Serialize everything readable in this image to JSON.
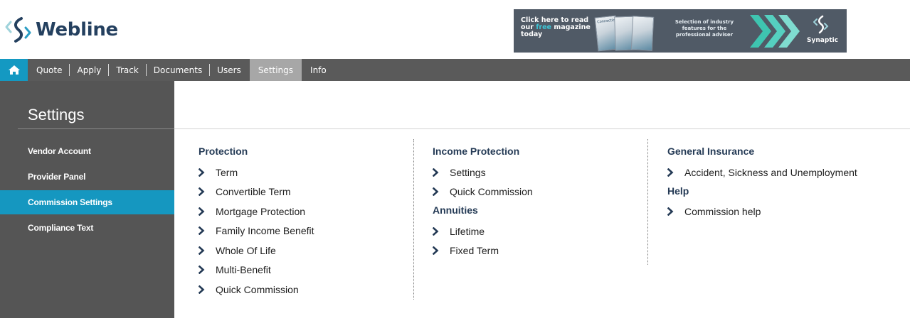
{
  "brand": {
    "name": "Webline",
    "colors": {
      "navy": "#24405f",
      "accent": "#1597c0",
      "nav_bg": "#5a5a5a",
      "sidebar_bg": "#555555"
    }
  },
  "banner": {
    "text_before": "Click here to read our ",
    "highlight": "free",
    "text_after": " magazine today",
    "magazine_label": "Connection",
    "tagline": "Selection of industry features for the professional adviser",
    "partner": "Synaptic"
  },
  "nav": {
    "home_icon": "home-icon",
    "items": [
      {
        "label": "Quote"
      },
      {
        "label": "Apply"
      },
      {
        "label": "Track"
      },
      {
        "label": "Documents"
      },
      {
        "label": "Users"
      },
      {
        "label": "Settings",
        "active": true
      },
      {
        "label": "Info"
      }
    ]
  },
  "sidebar": {
    "title": "Settings",
    "items": [
      {
        "label": "Vendor Account"
      },
      {
        "label": "Provider Panel"
      },
      {
        "label": "Commission Settings",
        "active": true
      },
      {
        "label": "Compliance Text"
      }
    ]
  },
  "columns": {
    "protection": {
      "heading": "Protection",
      "links": [
        "Term",
        "Convertible Term",
        "Mortgage Protection",
        "Family Income Benefit",
        "Whole Of Life",
        "Multi-Benefit",
        "Quick Commission"
      ]
    },
    "income_protection": {
      "heading": "Income Protection",
      "links": [
        "Settings",
        "Quick Commission"
      ]
    },
    "annuities": {
      "heading": "Annuities",
      "links": [
        "Lifetime",
        "Fixed Term"
      ]
    },
    "general_insurance": {
      "heading": "General Insurance",
      "links": [
        "Accident, Sickness and Unemployment"
      ]
    },
    "help": {
      "heading": "Help",
      "links": [
        "Commission help"
      ]
    }
  }
}
